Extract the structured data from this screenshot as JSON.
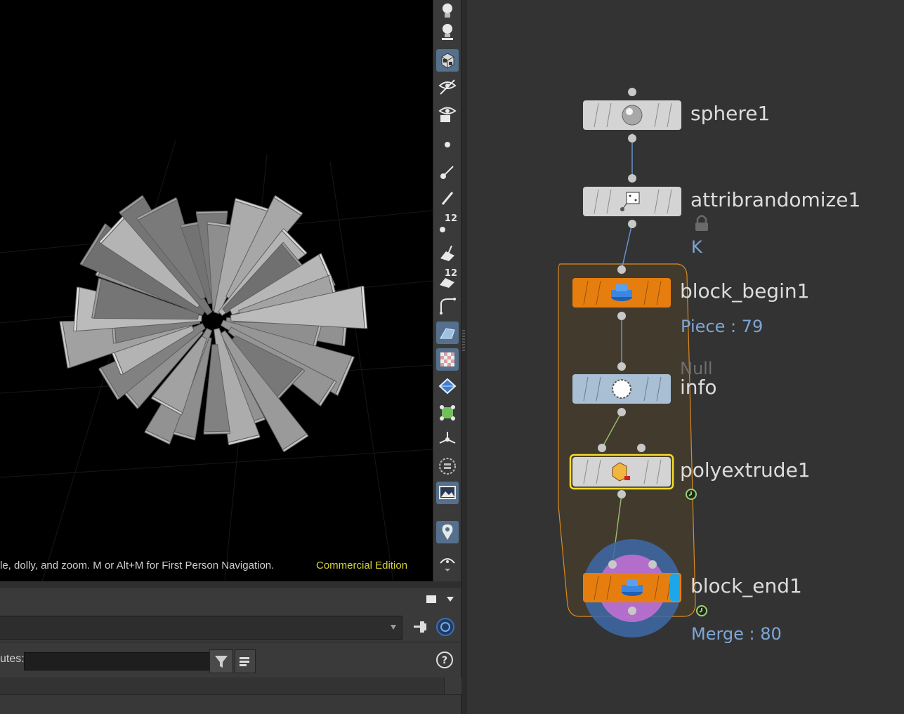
{
  "viewport": {
    "hint_text": "le, dolly, and zoom.   M or Alt+M for First Person Navigation.",
    "edition": "Commercial Edition"
  },
  "toolbar": {
    "tools": [
      {
        "icon": "light-bulb-icon",
        "active": false
      },
      {
        "icon": "headlight-icon",
        "active": false
      },
      {
        "icon": "shaded-cube-icon",
        "active": true
      },
      {
        "icon": "visibility-eye-icon",
        "active": false
      },
      {
        "icon": "camera-eye-icon",
        "active": false
      },
      {
        "icon": "point-icon",
        "active": false
      },
      {
        "icon": "normal-line-icon",
        "active": false
      },
      {
        "icon": "pen-icon",
        "active": false
      },
      {
        "icon": "point-numbers-icon",
        "active": false,
        "badge": "12"
      },
      {
        "icon": "primitive-normal-icon",
        "active": false
      },
      {
        "icon": "primitive-numbers-icon",
        "active": false,
        "badge": "12"
      },
      {
        "icon": "curve-icon",
        "active": false
      },
      {
        "icon": "shading-plane-icon",
        "active": true
      },
      {
        "icon": "checker-texture-icon",
        "active": true
      },
      {
        "icon": "uv-diamond-icon",
        "active": false
      },
      {
        "icon": "template-geometry-icon",
        "active": false
      },
      {
        "icon": "axis-handle-icon",
        "active": false
      },
      {
        "icon": "ghost-circle-icon",
        "active": false
      },
      {
        "icon": "background-image-icon",
        "active": true
      },
      {
        "icon": "location-pin-icon",
        "active": true
      },
      {
        "icon": "display-options-icon",
        "active": false
      }
    ]
  },
  "bottom_panel": {
    "filter_label": "utes:",
    "filter_placeholder": ""
  },
  "network": {
    "nodes": [
      {
        "name": "sphere1"
      },
      {
        "name": "attribrandomize1",
        "flag_text": "K"
      },
      {
        "name": "block_begin1",
        "info": "Piece : 79"
      },
      {
        "name": "info",
        "type_label": "Null"
      },
      {
        "name": "polyextrude1"
      },
      {
        "name": "block_end1",
        "info": "Merge : 80"
      }
    ]
  },
  "colors": {
    "node_gray": "#d4d4d4",
    "node_orange": "#e67e0f",
    "node_blue": "#a9bfd4",
    "selected": "#f5dd2a",
    "block_outline": "#d98a22",
    "info_text": "#7ea6d6"
  }
}
